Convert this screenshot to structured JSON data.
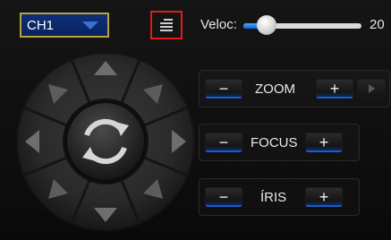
{
  "channel": {
    "selected": "CH1"
  },
  "menu": {
    "icon": "list-menu-icon"
  },
  "speed": {
    "label": "Veloc:",
    "value": "20",
    "level_fraction": 0.2
  },
  "ptz": {
    "icons": [
      "up-arrow-icon",
      "down-arrow-icon",
      "left-arrow-icon",
      "right-arrow-icon",
      "up-left-arrow-icon",
      "up-right-arrow-icon",
      "down-left-arrow-icon",
      "down-right-arrow-icon",
      "auto-rotate-icon"
    ]
  },
  "controls": {
    "minus_label": "−",
    "plus_label": "+",
    "zoom": {
      "label": "ZOOM"
    },
    "focus": {
      "label": "FOCUS"
    },
    "iris": {
      "label": "ÍRIS"
    }
  }
}
